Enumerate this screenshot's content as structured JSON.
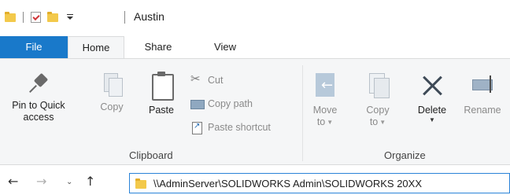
{
  "window": {
    "title": "Austin"
  },
  "tabs": {
    "file": "File",
    "home": "Home",
    "share": "Share",
    "view": "View"
  },
  "clipboard": {
    "group_label": "Clipboard",
    "pin_line1": "Pin to Quick",
    "pin_line2": "access",
    "copy": "Copy",
    "paste": "Paste",
    "cut": "Cut",
    "copy_path": "Copy path",
    "paste_shortcut": "Paste shortcut"
  },
  "organize": {
    "group_label": "Organize",
    "move_line1": "Move",
    "move_line2": "to",
    "copy_line1": "Copy",
    "copy_line2": "to",
    "delete": "Delete",
    "rename": "Rename"
  },
  "addressbar": {
    "path": "\\\\AdminServer\\SOLIDWORKS Admin\\SOLIDWORKS 20XX"
  },
  "colors": {
    "file_tab": "#1979ca",
    "ribbon_bg": "#f5f6f7",
    "address_border": "#2a83d8"
  }
}
